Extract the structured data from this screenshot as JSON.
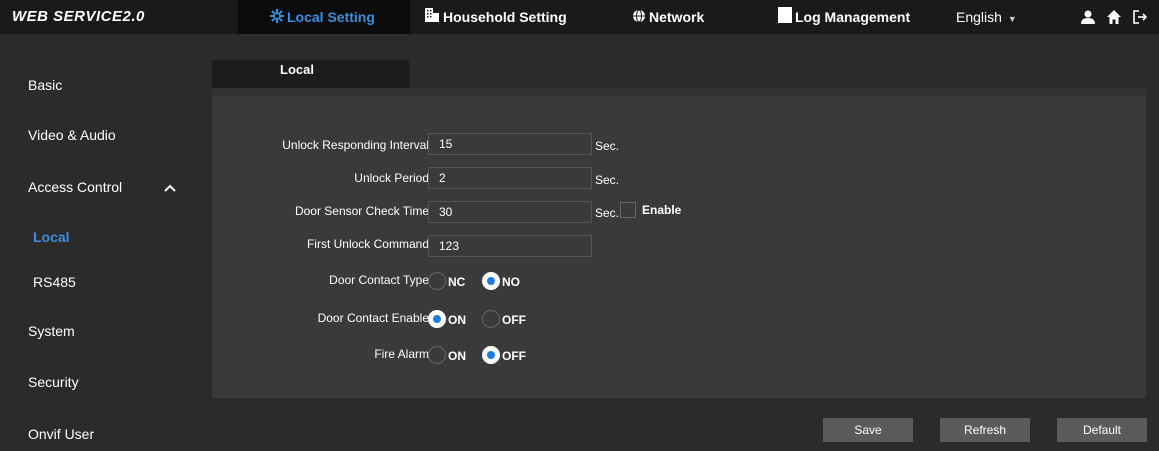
{
  "brand": "WEB SERVICE2.0",
  "nav": {
    "local_setting": "Local Setting",
    "household_setting": "Household Setting",
    "network": "Network",
    "log_management": "Log Management",
    "language": "English"
  },
  "sidebar": {
    "items": [
      "Basic",
      "Video & Audio",
      "Access Control",
      "Local",
      "RS485",
      "System",
      "Security",
      "Onvif User"
    ]
  },
  "tab": {
    "label": "Local"
  },
  "form": {
    "unlock_interval": {
      "label": "Unlock Responding Interval",
      "value": "15",
      "unit": "Sec."
    },
    "unlock_period": {
      "label": "Unlock Period",
      "value": "2",
      "unit": "Sec."
    },
    "door_sensor": {
      "label": "Door Sensor Check Time",
      "value": "30",
      "unit": "Sec.",
      "enable_label": "Enable",
      "enabled": false
    },
    "first_unlock": {
      "label": "First Unlock Command",
      "value": "123"
    },
    "door_contact_type": {
      "label": "Door Contact Type",
      "options": [
        "NC",
        "NO"
      ],
      "selected": "NO"
    },
    "door_contact_enable": {
      "label": "Door Contact Enable",
      "options": [
        "ON",
        "OFF"
      ],
      "selected": "ON"
    },
    "fire_alarm": {
      "label": "Fire Alarm",
      "options": [
        "ON",
        "OFF"
      ],
      "selected": "OFF"
    }
  },
  "buttons": {
    "save": "Save",
    "refresh": "Refresh",
    "default": "Default"
  },
  "colors": {
    "accent": "#3d8ede",
    "radio_selected": "#1e7de0",
    "panel": "#3a3a3a",
    "topbar": "#1a1a1a"
  }
}
